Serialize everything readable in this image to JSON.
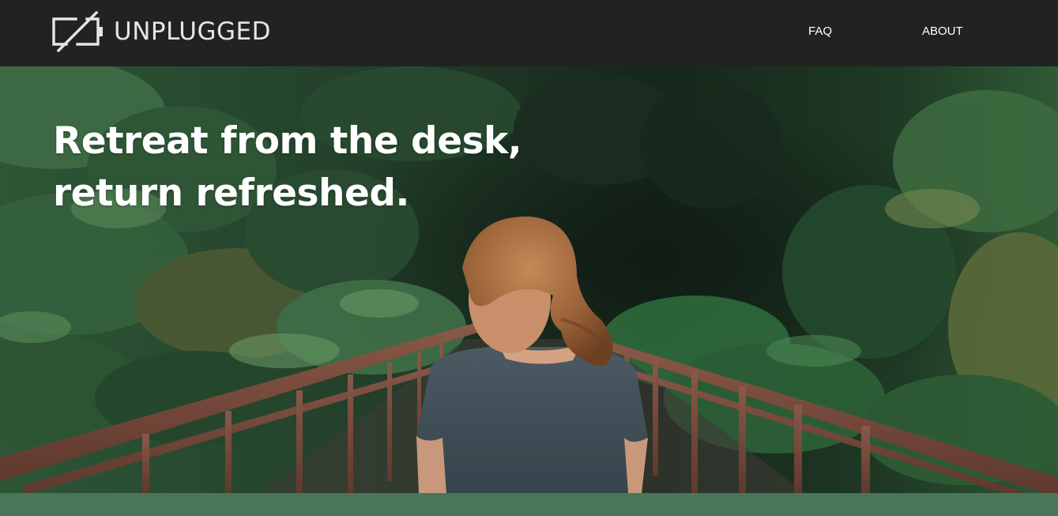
{
  "brand": {
    "name": "UNPLUGGED",
    "icon": "unplugged-battery-icon"
  },
  "nav": {
    "faq": "FAQ",
    "about": "ABOUT"
  },
  "hero": {
    "headline_line1": "Retreat from the desk,",
    "headline_line2": "return refreshed.",
    "photo": "woman-on-forest-bridge-photo"
  },
  "colors": {
    "navbar_bg": "#202322",
    "band": "#4a7558",
    "nav_text": "#ffffff",
    "logo_text": "#e6e6e6"
  }
}
